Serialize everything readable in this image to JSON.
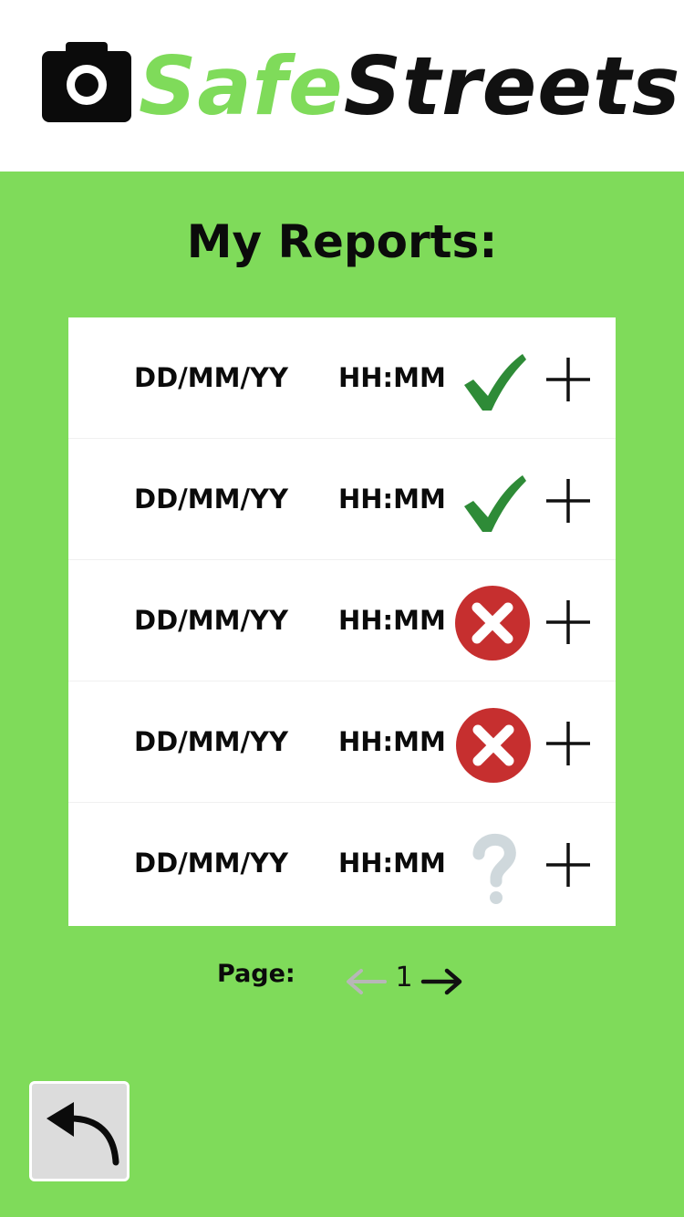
{
  "app": {
    "name_part1": "Safe",
    "name_part2": "Streets",
    "brand_green": "#7fdb5a",
    "brand_dark": "#111111"
  },
  "page": {
    "title": "My Reports:"
  },
  "reports": [
    {
      "date": "DD/MM/YY",
      "time": "HH:MM",
      "status": "approved",
      "status_icon": "checkmark-icon",
      "expand_icon": "plus-icon"
    },
    {
      "date": "DD/MM/YY",
      "time": "HH:MM",
      "status": "approved",
      "status_icon": "checkmark-icon",
      "expand_icon": "plus-icon"
    },
    {
      "date": "DD/MM/YY",
      "time": "HH:MM",
      "status": "rejected",
      "status_icon": "cross-circle-icon",
      "expand_icon": "plus-icon"
    },
    {
      "date": "DD/MM/YY",
      "time": "HH:MM",
      "status": "rejected",
      "status_icon": "cross-circle-icon",
      "expand_icon": "plus-icon"
    },
    {
      "date": "DD/MM/YY",
      "time": "HH:MM",
      "status": "pending",
      "status_icon": "question-mark-icon",
      "expand_icon": "plus-icon"
    }
  ],
  "pagination": {
    "label": "Page:",
    "current": "1",
    "prev_icon": "arrow-left-icon",
    "next_icon": "arrow-right-icon"
  },
  "navigation": {
    "back_icon": "back-arrow-icon"
  },
  "colors": {
    "check_green": "#2e8b37",
    "cross_red": "#c62f2f",
    "question_grey": "#cfd8dc"
  }
}
